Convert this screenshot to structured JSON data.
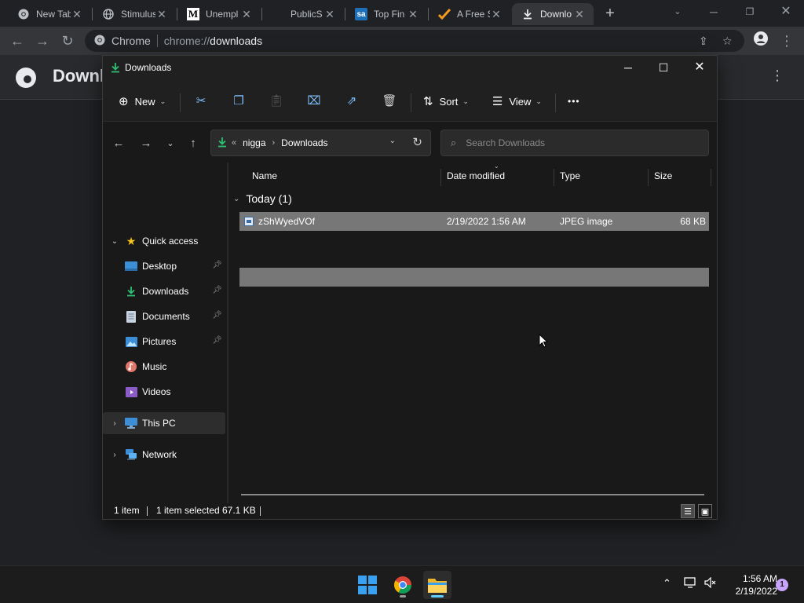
{
  "chrome": {
    "tabs": [
      {
        "title": "New Tab"
      },
      {
        "title": "Stimulus"
      },
      {
        "title": "Unempl"
      },
      {
        "title": "PublicS"
      },
      {
        "title": "Top Fin"
      },
      {
        "title": "A Free S"
      },
      {
        "title": "Downlo"
      }
    ],
    "new_tab_label": "+",
    "omnibox": {
      "label": "Chrome",
      "url_scheme": "chrome://",
      "url_host": "downloads"
    }
  },
  "downloads_page": {
    "title": "Downl"
  },
  "explorer": {
    "window_title": "Downloads",
    "commands": {
      "new_label": "New",
      "sort_label": "Sort",
      "view_label": "View",
      "more_label": "•••"
    },
    "address": {
      "overflow": "«",
      "crumbs": [
        "nigga",
        "Downloads"
      ]
    },
    "search_placeholder": "Search Downloads",
    "nav": {
      "quick_access": "Quick access",
      "items": [
        {
          "label": "Desktop",
          "pinned": true
        },
        {
          "label": "Downloads",
          "pinned": true
        },
        {
          "label": "Documents",
          "pinned": true
        },
        {
          "label": "Pictures",
          "pinned": true
        },
        {
          "label": "Music",
          "pinned": false
        },
        {
          "label": "Videos",
          "pinned": false
        }
      ],
      "this_pc": "This PC",
      "network": "Network"
    },
    "columns": {
      "name": "Name",
      "date": "Date modified",
      "type": "Type",
      "size": "Size"
    },
    "group": {
      "label": "Today (1)"
    },
    "files": [
      {
        "name": "zShWyedVOf",
        "date": "2/19/2022 1:56 AM",
        "type": "JPEG image",
        "size": "68 KB"
      }
    ],
    "status": {
      "count": "1 item",
      "selected": "1 item selected",
      "size": "67.1 KB"
    }
  },
  "taskbar": {
    "time": "1:56 AM",
    "date": "2/19/2022",
    "notification_count": "1"
  },
  "colors": {
    "accent_green": "#2fbf71",
    "selection": "#777777",
    "windows_blue": "#60cdff"
  }
}
